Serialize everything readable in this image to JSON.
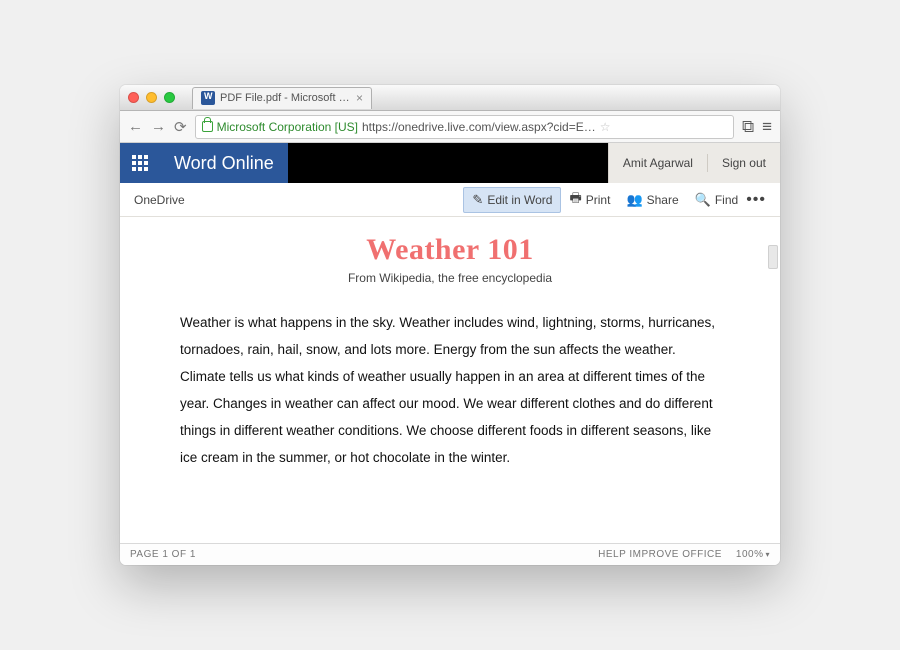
{
  "browser": {
    "tab_title": "PDF File.pdf - Microsoft W…",
    "ev_label": "Microsoft Corporation [US]",
    "url_rest": "https://onedrive.live.com/view.aspx?cid=E…"
  },
  "header": {
    "brand": "Word Online",
    "user": "Amit Agarwal",
    "signout": "Sign out"
  },
  "cmd": {
    "breadcrumb": "OneDrive",
    "edit": "Edit in Word",
    "print": "Print",
    "share": "Share",
    "find": "Find"
  },
  "doc": {
    "title": "Weather 101",
    "subtitle": "From Wikipedia, the free encyclopedia",
    "body": "Weather is what happens in the sky. Weather includes wind, lightning, storms, hurricanes, tornadoes, rain, hail, snow, and lots more. Energy from the sun affects the weather. Climate tells us what kinds of weather usually happen in an area at different times of the year. Changes in weather can affect our mood. We wear different clothes and do different things in different weather conditions. We choose different foods in different seasons, like ice cream in the summer, or hot chocolate in the winter."
  },
  "status": {
    "page": "PAGE 1 OF 1",
    "help": "HELP IMPROVE OFFICE",
    "zoom": "100%"
  }
}
